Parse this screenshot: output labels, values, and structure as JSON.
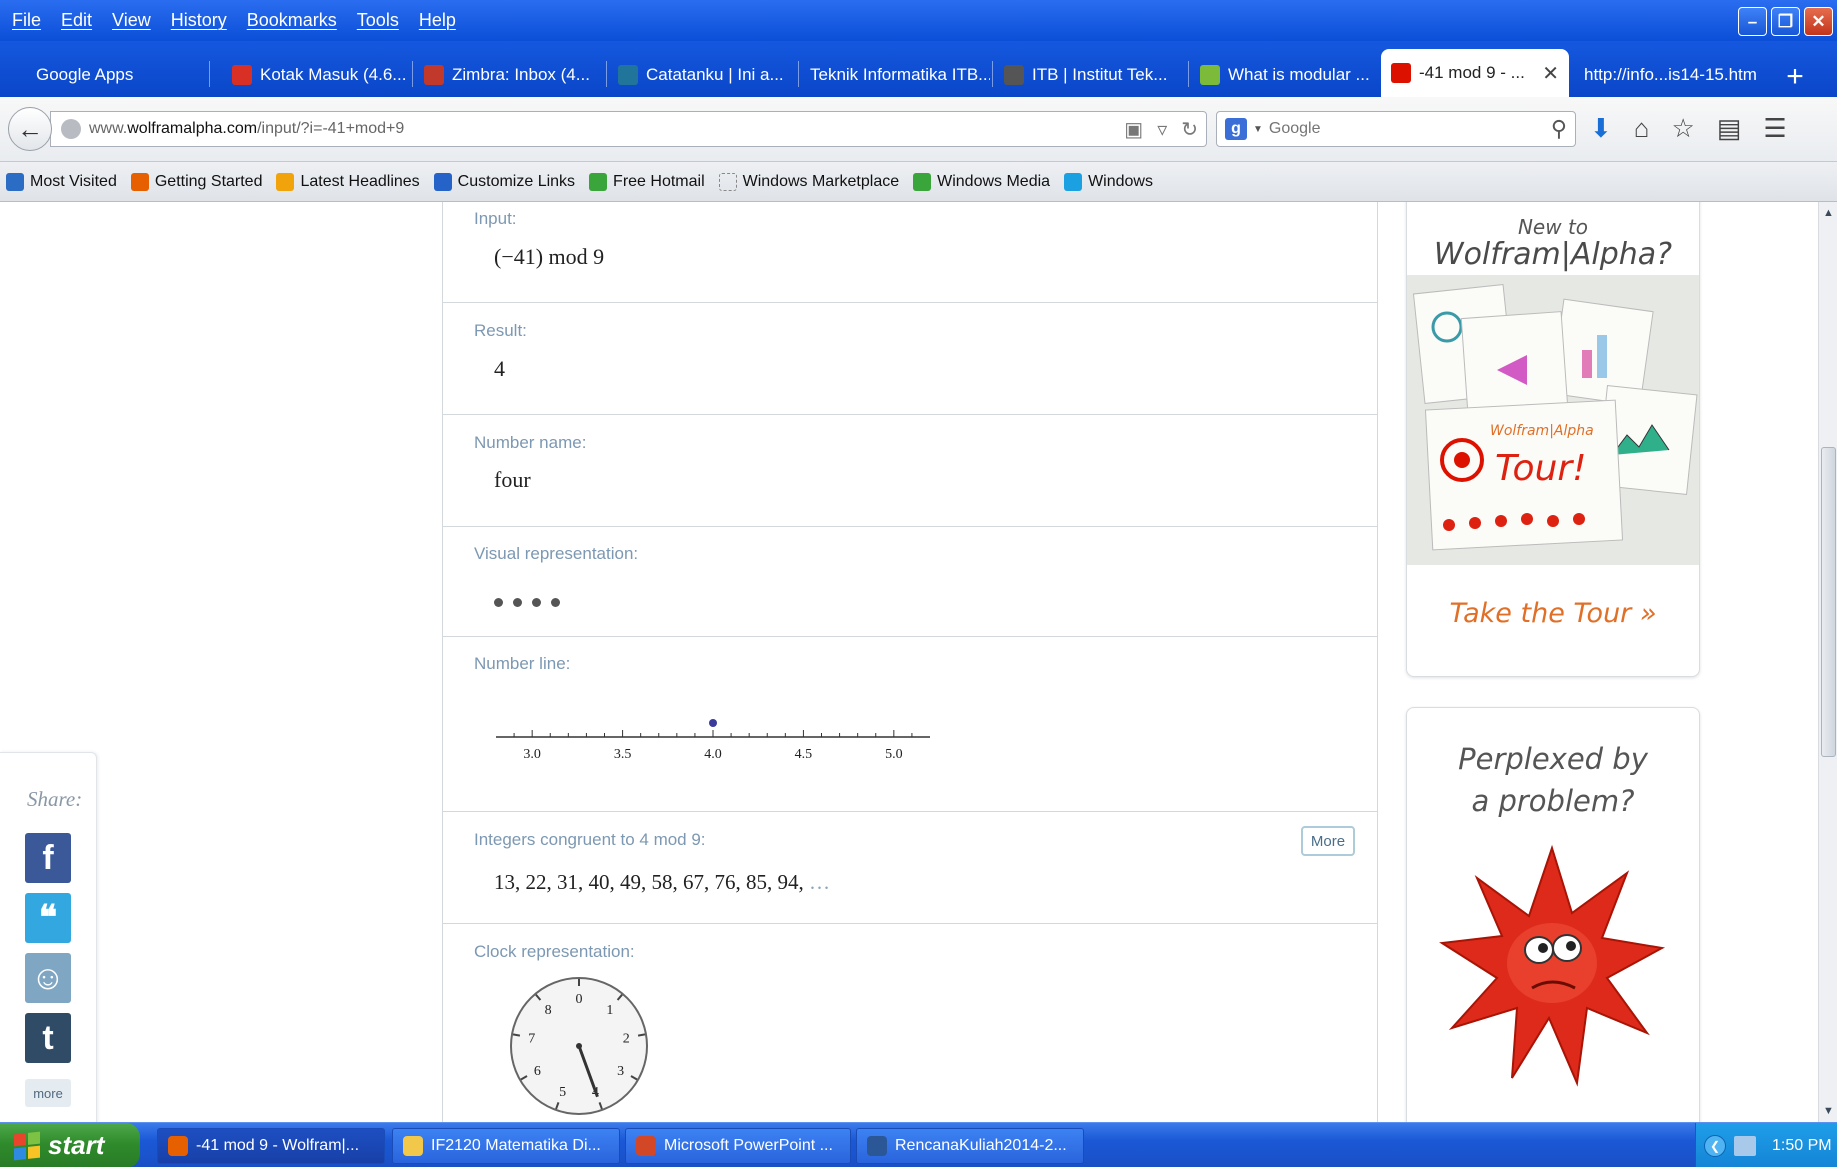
{
  "menu": [
    "File",
    "Edit",
    "View",
    "History",
    "Bookmarks",
    "Tools",
    "Help"
  ],
  "window_buttons": {
    "minimize": "–",
    "restore": "❐",
    "close": "✕"
  },
  "tabs": [
    {
      "label": "Google Apps",
      "icon": "none",
      "color": ""
    },
    {
      "label": "Kotak Masuk (4.6...",
      "icon": "gmail-icon",
      "color": "#d93025"
    },
    {
      "label": "Zimbra: Inbox (4...",
      "icon": "zimbra-icon",
      "color": "#c0392b"
    },
    {
      "label": "Catatanku | Ini a...",
      "icon": "wordpress-icon",
      "color": "#21759b"
    },
    {
      "label": "Teknik Informatika ITB...",
      "icon": "none",
      "color": ""
    },
    {
      "label": "ITB | Institut Tek...",
      "icon": "itb-icon",
      "color": "#555555"
    },
    {
      "label": "What is modular ...",
      "icon": "leaf-icon",
      "color": "#7cbb3a"
    },
    {
      "label": "-41 mod 9 - ...",
      "icon": "wolfram-icon",
      "color": "#dd1100",
      "active": true
    },
    {
      "label": "http://info...is14-15.htm",
      "icon": "none",
      "color": ""
    }
  ],
  "url": {
    "host": "www.",
    "domain": "wolframalpha.com",
    "path": "/input/?i=-41+mod+9"
  },
  "search": {
    "placeholder": "Google",
    "engine_glyph": "g"
  },
  "bookmarks": [
    {
      "label": "Most Visited",
      "icon": "most-visited-icon",
      "color": "#2b6cc4"
    },
    {
      "label": "Getting Started",
      "icon": "firefox-icon",
      "color": "#e66000"
    },
    {
      "label": "Latest Headlines",
      "icon": "rss-icon",
      "color": "#f0a30a"
    },
    {
      "label": "Customize Links",
      "icon": "msn-icon",
      "color": "#2563c9"
    },
    {
      "label": "Free Hotmail",
      "icon": "windows-flag-icon",
      "color": "#3aa53a"
    },
    {
      "label": "Windows Marketplace",
      "icon": "blank-page-icon",
      "color": "#cccccc"
    },
    {
      "label": "Windows Media",
      "icon": "windows-flag-icon",
      "color": "#3aa53a"
    },
    {
      "label": "Windows",
      "icon": "windows-logo-icon",
      "color": "#1ba1e2"
    }
  ],
  "pods": {
    "input": {
      "title": "Input:",
      "value": "(−41) mod 9"
    },
    "result": {
      "title": "Result:",
      "value": "4"
    },
    "number_name": {
      "title": "Number name:",
      "value": "four"
    },
    "visual": {
      "title": "Visual representation:",
      "dot_count": 4
    },
    "number_line": {
      "title": "Number line:",
      "ticks": [
        "3.0",
        "3.5",
        "4.0",
        "4.5",
        "5.0"
      ],
      "point": 4.0,
      "range": [
        2.8,
        5.2
      ]
    },
    "congruent": {
      "title": "Integers congruent to 4 mod 9:",
      "value": "13, 22, 31, 40, 49, 58, 67, 76, 85, 94,",
      "ellipsis": "…",
      "more": "More"
    },
    "clock": {
      "title": "Clock representation:",
      "labels": [
        "0",
        "1",
        "2",
        "3",
        "4",
        "5",
        "6",
        "7",
        "8"
      ],
      "hand": 4
    }
  },
  "share": {
    "label": "Share:",
    "more": "more",
    "buttons": [
      {
        "name": "facebook",
        "glyph": "f",
        "color": "#3b5998"
      },
      {
        "name": "twitter",
        "glyph": "❝",
        "color": "#33a8e0"
      },
      {
        "name": "reddit",
        "glyph": "☺",
        "color": "#7fa6c3"
      },
      {
        "name": "tumblr",
        "glyph": "t",
        "color": "#2f4b66"
      }
    ]
  },
  "ad_tour": {
    "new_to": "New to",
    "brand": "Wolfram|Alpha?",
    "card_brand": "Wolfram|Alpha",
    "card_word": "Tour!",
    "cta": "Take the Tour »"
  },
  "ad_problem": {
    "line1": "Perplexed by",
    "line2": "a problem?"
  },
  "taskbar": {
    "start": "start",
    "tasks": [
      {
        "label": "-41 mod 9 - Wolfram|...",
        "color": "#e66000",
        "active": true
      },
      {
        "label": "IF2120 Matematika Di...",
        "color": "#f2c84b"
      },
      {
        "label": "Microsoft PowerPoint ...",
        "color": "#d24726"
      },
      {
        "label": "RencanaKuliah2014-2...",
        "color": "#2b5797"
      }
    ],
    "clock": "1:50 PM"
  }
}
